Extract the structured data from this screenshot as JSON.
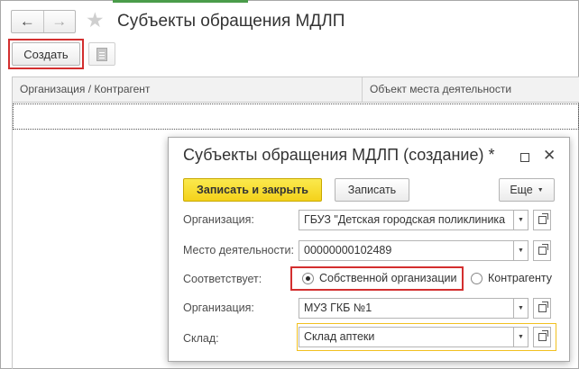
{
  "window": {
    "title": "Субъекты обращения МДЛП",
    "back_icon": "←",
    "forward_icon": "→",
    "favorite_icon": "★"
  },
  "toolbar": {
    "create_label": "Создать"
  },
  "list": {
    "columns": [
      "Организация / Контрагент",
      "Объект места деятельности"
    ]
  },
  "dialog": {
    "title": "Субъекты обращения МДЛП (создание) *",
    "close_icon": "✕",
    "buttons": {
      "save_close": "Записать и закрыть",
      "save": "Записать",
      "more": "Еще"
    },
    "fields": {
      "organization_label": "Организация:",
      "organization_value": "ГБУЗ \"Детская городская поликлиника",
      "place_label": "Место деятельности:",
      "place_value": "00000000102489",
      "corresponds_label": "Соответствует:",
      "radio_own": "Собственной организации",
      "radio_counterparty": "Контрагенту",
      "org2_label": "Организация:",
      "org2_value": "МУЗ ГКБ №1",
      "warehouse_label": "Склад:",
      "warehouse_value": "Склад аптеки"
    },
    "dropdown_icon": "▼"
  },
  "colors": {
    "primary_button": "#f4d21b",
    "highlight_red": "#d32f2f",
    "highlight_yellow": "#f2c11f"
  }
}
